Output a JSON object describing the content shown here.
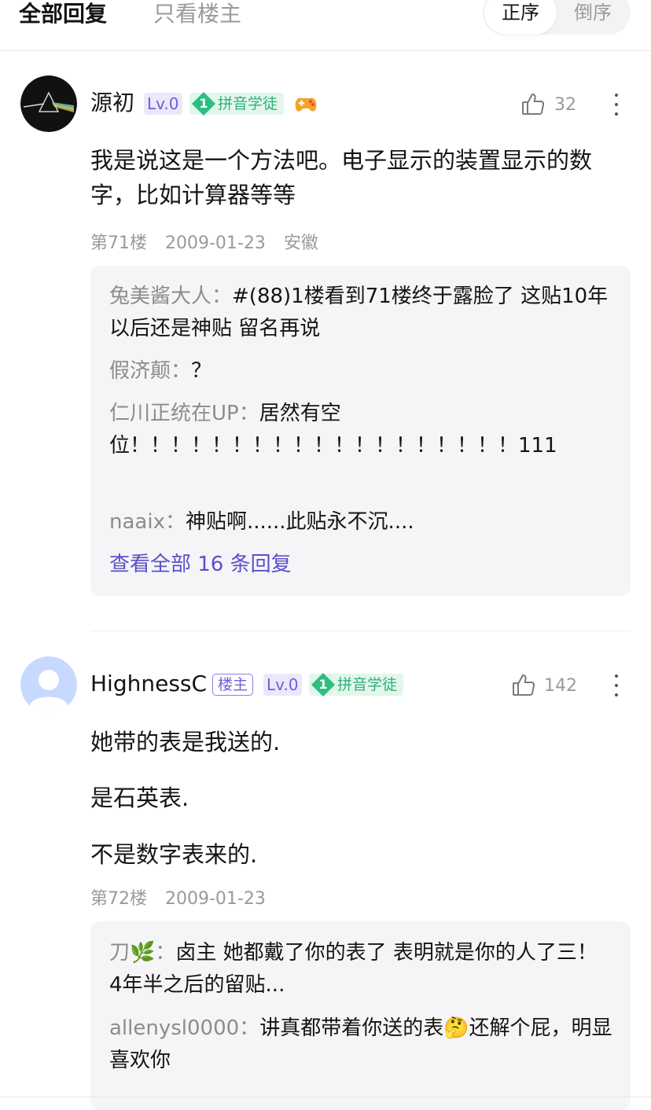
{
  "tabs": {
    "all_replies": "全部回复",
    "op_only": "只看楼主"
  },
  "sort": {
    "asc": "正序",
    "desc": "倒序",
    "active": "asc"
  },
  "posts": [
    {
      "username": "源初",
      "level": "Lv.0",
      "rank_num": "1",
      "rank_title": "拼音学徒",
      "likes": "32",
      "content": "我是说这是一个方法吧。电子显示的装置显示的数字，比如计算器等等",
      "floor": "第71楼",
      "date": "2009-01-23",
      "location": "安徽",
      "replies": [
        {
          "user": "兔美酱大人：",
          "text": "#(88)1楼看到71楼终于露脸了 这贴10年以后还是神贴 留名再说"
        },
        {
          "user": "假济颠：",
          "text": "？"
        },
        {
          "user": "仁川正统在UP：",
          "text": "居然有空位！！！！！！！！！！！！！！！！！！！111"
        },
        {
          "user": "naaix：",
          "text": "神贴啊......此贴永不沉...."
        }
      ],
      "view_all": "查看全部 16 条回复"
    },
    {
      "username": "HighnessC",
      "op_badge": "楼主",
      "level": "Lv.0",
      "rank_num": "1",
      "rank_title": "拼音学徒",
      "likes": "142",
      "content_lines": [
        "她带的表是我送的.",
        "是石英表.",
        "不是数字表来的."
      ],
      "floor": "第72楼",
      "date": "2009-01-23",
      "replies": [
        {
          "user": "刀🌿：",
          "text": "卤主 她都戴了你的表了 表明就是你的人了三！ 4年半之后的留贴..."
        },
        {
          "user": "allenysl0000：",
          "text": "讲真都带着你送的表🤔还解个屁，明显喜欢你"
        }
      ]
    }
  ]
}
